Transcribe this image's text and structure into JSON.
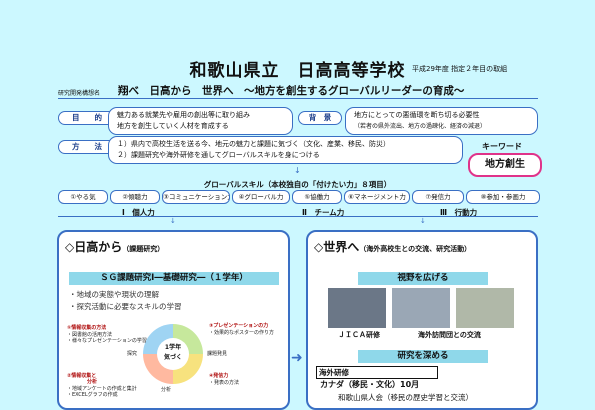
{
  "header": {
    "school_name": "和歌山県立　日高高等学校",
    "year_note": "平成29年度 指定２年目の取組",
    "concept_label": "研究開発構想名",
    "concept": "翔べ　日高から　世界へ　〜地方を創生するグローバルリーダーの育成〜"
  },
  "purpose": {
    "label": "目　　的",
    "lines": [
      "魅力ある就業先や雇用の創出等に取り組み",
      "地方を創生していく人材を育成する"
    ]
  },
  "background": {
    "label": "背　景",
    "lines": [
      "地方にとっての悪循環を断ち切る必要性",
      "（若者の県外流出、地方の過疎化、経済の減退）"
    ]
  },
  "method": {
    "label": "方　　法",
    "lines": [
      "１）県内で高校生活を送る今、地元の魅力と課題に気づく（文化、産業、移民、防災）",
      "２）課題研究や海外研修を通してグローバルスキルを身につける"
    ]
  },
  "keyword": {
    "label": "キーワード",
    "value": "地方創生"
  },
  "skills": {
    "title": "グローバルスキル（本校独自の「付けたい力」８項目）",
    "items": [
      "①やる気",
      "②傾聴力",
      "③コミュニケーション力",
      "④グローバル力",
      "⑤協働力",
      "⑥マネージメント力",
      "⑦発信力",
      "⑧参加・参画力"
    ],
    "groups": [
      "Ⅰ　個人力",
      "Ⅱ　チーム力",
      "Ⅲ　行動力"
    ]
  },
  "left_panel": {
    "heading": "◇日高から",
    "heading_note": "（課題研究）",
    "ribbon": "ＳＧ課題研究Ⅰ―基礎研究―（１学年）",
    "bullets": [
      "・地域の実態や現状の理解",
      "・探究活動に必要なスキルの学習"
    ],
    "cycle_center": [
      "1学年",
      "気づく"
    ],
    "cycle_items": [
      "①情報収集の方法",
      "②情報収集と",
      "分析",
      "③プレゼンテーションの力",
      "④発信力"
    ],
    "cycle_notes": [
      "・図書館の活用方法",
      "・様々なプレゼンテーションの学習",
      "・効果的なポスターの作り方",
      "・地域アンケートの作成と集計",
      "・EXCELグラフの作成",
      "・発表の方法"
    ],
    "small_labels": [
      "探究",
      "課題発見",
      "分析"
    ]
  },
  "right_panel": {
    "heading": "◇世界へ",
    "heading_note": "（海外高校生との交流、研究活動）",
    "ribbon1": "視野を広げる",
    "photo_captions": [
      "ＪＩＣＡ研修",
      "海外訪問団との交流"
    ],
    "ribbon2": "研究を深める",
    "overseas_title": "海外研修",
    "overseas_line1": "カナダ（移民・文化）10月",
    "overseas_line2": "和歌山県人会（移民の歴史学習と交流）"
  },
  "colors": {
    "background": "#ccf8ff",
    "border": "#3a6fc4",
    "accent": "#e0338a",
    "ribbon": "#8fd8ea"
  }
}
